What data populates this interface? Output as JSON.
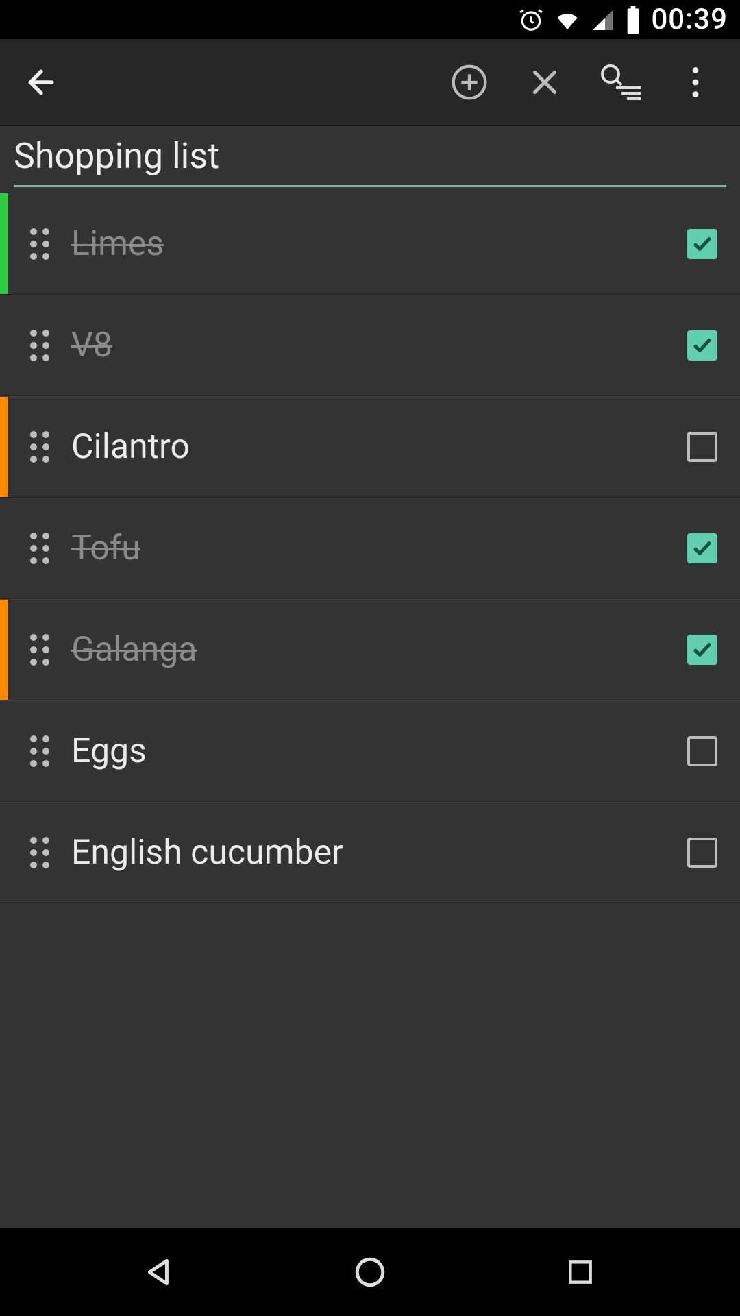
{
  "status": {
    "time": "00:39"
  },
  "title": "Shopping list",
  "colors": {
    "accent": "#5fcfaf",
    "stripe_green": "#2ecc40",
    "stripe_orange": "#ff8a00"
  },
  "items": [
    {
      "label": "Limes",
      "done": true,
      "stripe": "green"
    },
    {
      "label": "V8",
      "done": true,
      "stripe": "none"
    },
    {
      "label": "Cilantro",
      "done": false,
      "stripe": "orange"
    },
    {
      "label": "Tofu",
      "done": true,
      "stripe": "none"
    },
    {
      "label": "Galanga",
      "done": true,
      "stripe": "orange"
    },
    {
      "label": "Eggs",
      "done": false,
      "stripe": "none"
    },
    {
      "label": "English cucumber",
      "done": false,
      "stripe": "none"
    }
  ]
}
